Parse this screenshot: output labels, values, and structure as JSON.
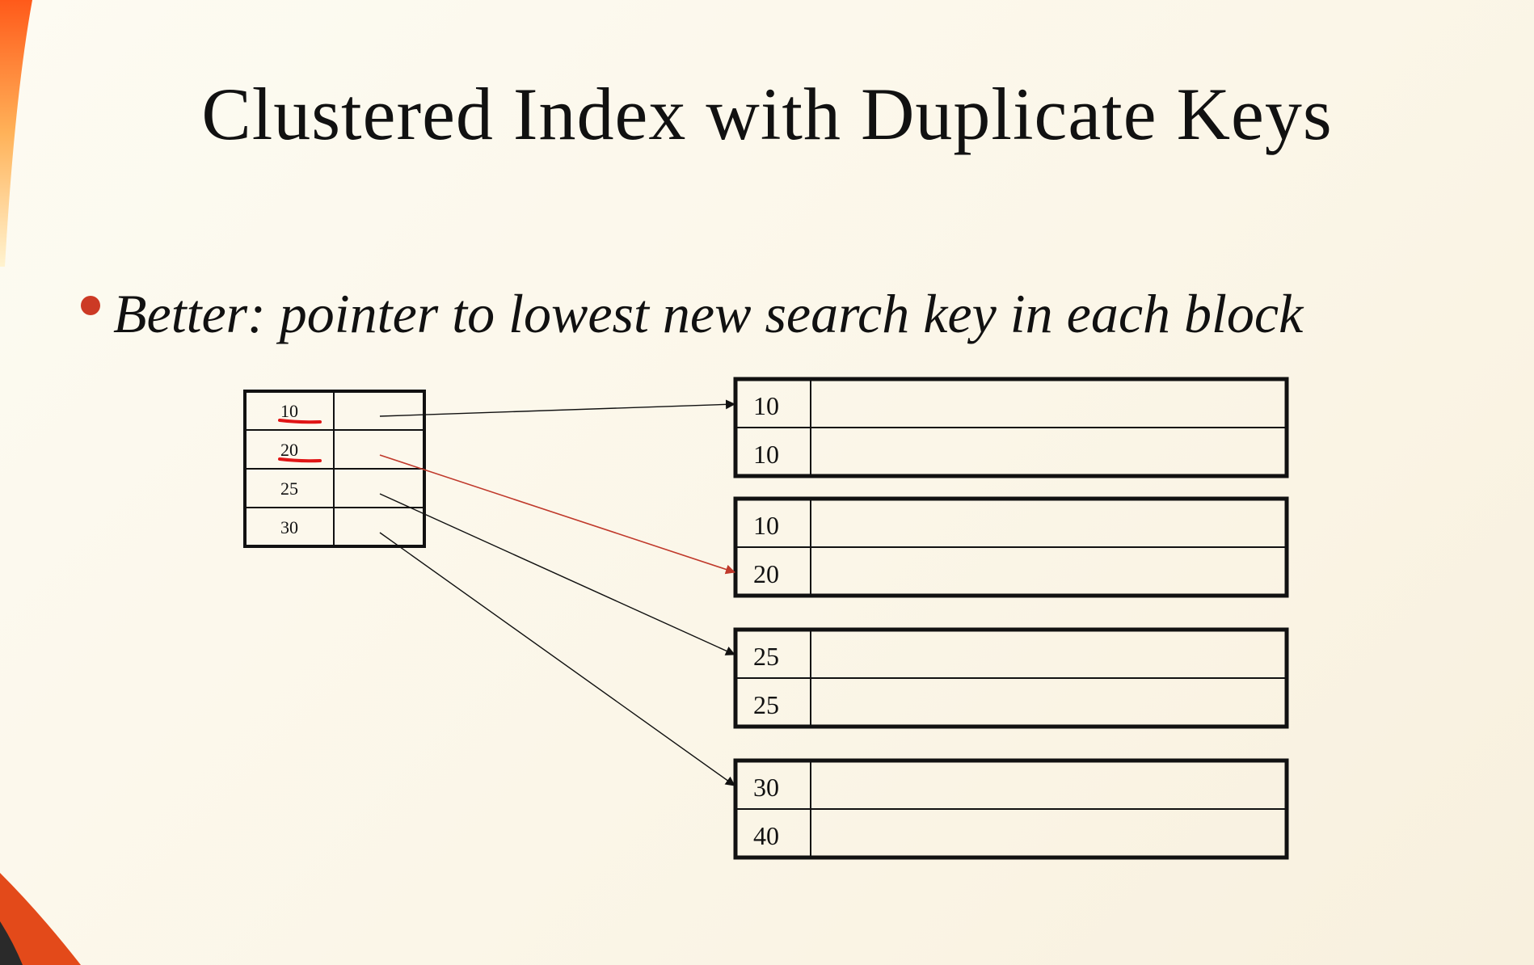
{
  "title": "Clustered Index with Duplicate Keys",
  "bullet": "Better: pointer to lowest new search key in each block",
  "colors": {
    "bullet": "#cc3a25",
    "highlight_arrow": "#c0392b",
    "highlight_key": "#b8501a",
    "annotation_underline": "#e01515",
    "border": "#111111"
  },
  "index": {
    "entries": [
      {
        "key": "10",
        "highlight": false
      },
      {
        "key": "20",
        "highlight": true
      },
      {
        "key": "25",
        "highlight": false
      },
      {
        "key": "30",
        "highlight": false
      }
    ]
  },
  "blocks": [
    {
      "keys": [
        "10",
        "10"
      ]
    },
    {
      "keys": [
        "10",
        "20"
      ]
    },
    {
      "keys": [
        "25",
        "25"
      ]
    },
    {
      "keys": [
        "30",
        "40"
      ]
    }
  ],
  "arrows": [
    {
      "from_entry": 0,
      "to_block": 0,
      "to_row": 0,
      "color": "black"
    },
    {
      "from_entry": 1,
      "to_block": 1,
      "to_row": 1,
      "color": "red"
    },
    {
      "from_entry": 2,
      "to_block": 2,
      "to_row": 0,
      "color": "black"
    },
    {
      "from_entry": 3,
      "to_block": 3,
      "to_row": 0,
      "color": "black"
    }
  ],
  "annotations": {
    "underlined_entries": [
      0,
      1
    ]
  }
}
